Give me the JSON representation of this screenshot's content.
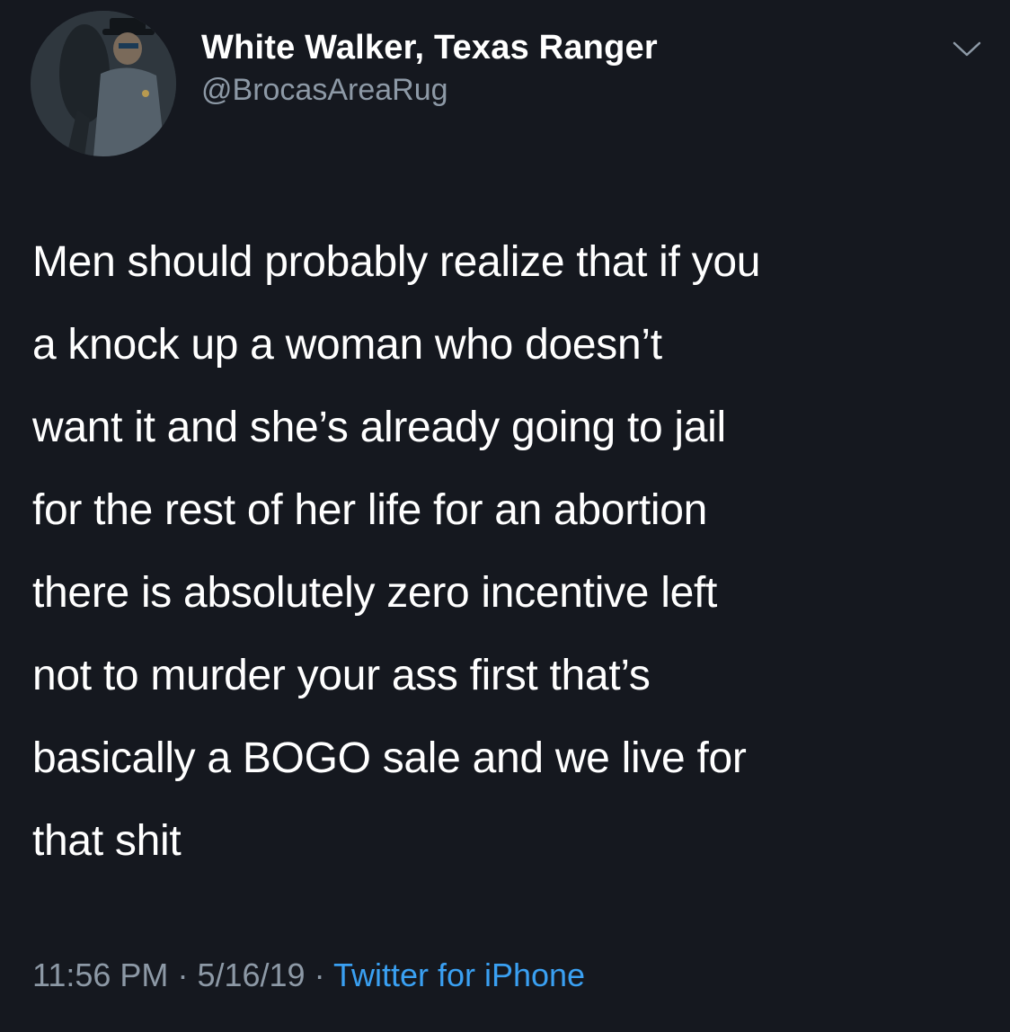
{
  "author": {
    "display_name": "White Walker, Texas Ranger",
    "handle": "@BrocasAreaRug"
  },
  "tweet": {
    "lines": [
      "Men should probably realize that if you",
      "a knock up a woman who doesn’t",
      "want it and she’s already going to jail",
      "for the rest of her life for an abortion",
      "there is absolutely zero incentive left",
      "not to murder your ass first that’s",
      "basically a BOGO sale and we live for",
      "that shit"
    ]
  },
  "meta": {
    "time": "11:56 PM",
    "separator": "·",
    "date": "5/16/19",
    "source": "Twitter for iPhone"
  },
  "icons": {
    "menu": "chevron-down-icon",
    "avatar": "avatar"
  },
  "colors": {
    "background": "#15181f",
    "text_primary": "#ffffff",
    "text_secondary": "#8d99a6",
    "link": "#3aa0f2"
  }
}
